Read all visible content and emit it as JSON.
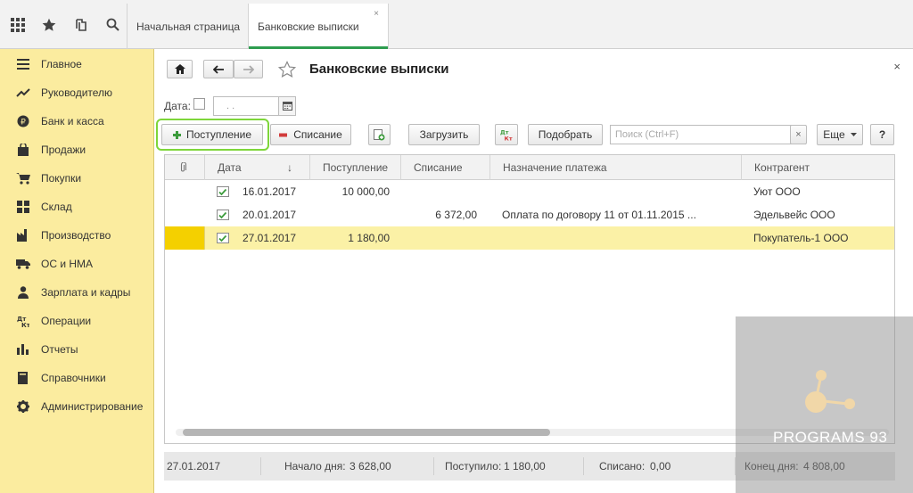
{
  "tabs": {
    "home": "Начальная страница",
    "active": "Банковские выписки",
    "close": "×"
  },
  "sidebar": {
    "items": [
      {
        "label": "Главное",
        "icon": "menu-lines-icon"
      },
      {
        "label": "Руководителю",
        "icon": "trend-chart-icon"
      },
      {
        "label": "Банк и касса",
        "icon": "coin-icon"
      },
      {
        "label": "Продажи",
        "icon": "shopping-bag-icon"
      },
      {
        "label": "Покупки",
        "icon": "cart-icon"
      },
      {
        "label": "Склад",
        "icon": "warehouse-icon"
      },
      {
        "label": "Производство",
        "icon": "factory-icon"
      },
      {
        "label": "ОС и НМА",
        "icon": "truck-icon"
      },
      {
        "label": "Зарплата и кадры",
        "icon": "person-icon"
      },
      {
        "label": "Операции",
        "icon": "dt-kt-icon"
      },
      {
        "label": "Отчеты",
        "icon": "bar-chart-icon"
      },
      {
        "label": "Справочники",
        "icon": "book-icon"
      },
      {
        "label": "Администрирование",
        "icon": "gear-icon"
      }
    ]
  },
  "toolbar": {
    "title": "Банковские выписки",
    "date_label": "Дата:",
    "date_placeholder": ". .",
    "receipt_label": "Поступление",
    "writeoff_label": "Списание",
    "load_label": "Загрузить",
    "pick_label": "Подобрать",
    "search_placeholder": "Поиск (Ctrl+F)",
    "search_clear": "×",
    "more_label": "Еще",
    "help_label": "?",
    "close": "×"
  },
  "table": {
    "columns": {
      "date": "Дата",
      "sort_arrow": "↓",
      "receipt": "Поступление",
      "writeoff": "Списание",
      "purpose": "Назначение платежа",
      "counterparty": "Контрагент"
    },
    "rows": [
      {
        "date": "16.01.2017",
        "receipt": "10 000,00",
        "writeoff": "",
        "purpose": "",
        "counterparty": "Уют ООО"
      },
      {
        "date": "20.01.2017",
        "receipt": "",
        "writeoff": "6 372,00",
        "purpose": "Оплата по договору 11 от 01.11.2015 ...",
        "counterparty": "Эдельвейс ООО"
      },
      {
        "date": "27.01.2017",
        "receipt": "1 180,00",
        "writeoff": "",
        "purpose": "",
        "counterparty": "Покупатель-1 ООО"
      }
    ]
  },
  "footer": {
    "date": "27.01.2017",
    "start_label": "Начало дня:",
    "start_value": "3 628,00",
    "in_label": "Поступило:",
    "in_value": "1 180,00",
    "out_label": "Списано:",
    "out_value": "0,00",
    "end_label": "Конец дня:",
    "end_value": "4 808,00"
  },
  "watermark": {
    "text": "PROGRAMS 93"
  },
  "colors": {
    "sidebar_bg": "#fbec9f",
    "selected_row": "#fbf1a6",
    "selected_marker": "#f4d000",
    "tab_accent": "#2e9d4f",
    "highlight_border": "#7ed63a"
  }
}
